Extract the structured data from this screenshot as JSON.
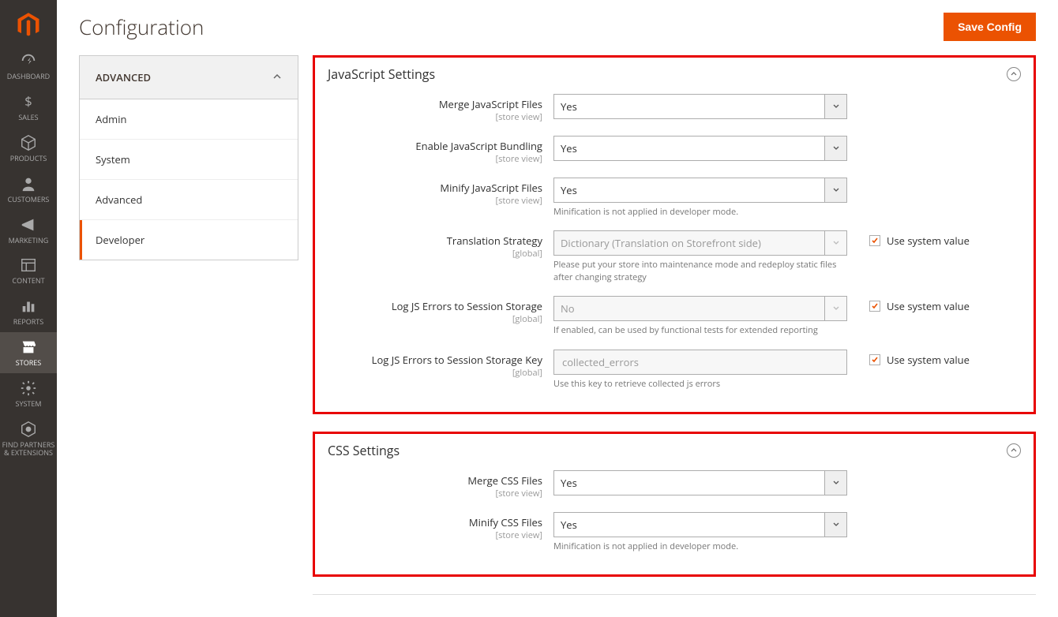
{
  "page": {
    "title": "Configuration",
    "save_button": "Save Config"
  },
  "nav": {
    "items": [
      {
        "label": "DASHBOARD"
      },
      {
        "label": "SALES"
      },
      {
        "label": "PRODUCTS"
      },
      {
        "label": "CUSTOMERS"
      },
      {
        "label": "MARKETING"
      },
      {
        "label": "CONTENT"
      },
      {
        "label": "REPORTS"
      },
      {
        "label": "STORES"
      },
      {
        "label": "SYSTEM"
      },
      {
        "label": "FIND PARTNERS & EXTENSIONS"
      }
    ]
  },
  "sidebar": {
    "heading": "ADVANCED",
    "items": [
      {
        "label": "Admin"
      },
      {
        "label": "System"
      },
      {
        "label": "Advanced"
      },
      {
        "label": "Developer"
      }
    ]
  },
  "js": {
    "title": "JavaScript Settings",
    "merge_label": "Merge JavaScript Files",
    "merge_scope": "[store view]",
    "merge_value": "Yes",
    "bundle_label": "Enable JavaScript Bundling",
    "bundle_scope": "[store view]",
    "bundle_value": "Yes",
    "minify_label": "Minify JavaScript Files",
    "minify_scope": "[store view]",
    "minify_value": "Yes",
    "minify_note": "Minification is not applied in developer mode.",
    "trans_label": "Translation Strategy",
    "trans_scope": "[global]",
    "trans_value": "Dictionary (Translation on Storefront side)",
    "trans_note": "Please put your store into maintenance mode and redeploy static files after changing strategy",
    "log_label": "Log JS Errors to Session Storage",
    "log_scope": "[global]",
    "log_value": "No",
    "log_note": "If enabled, can be used by functional tests for extended reporting",
    "logkey_label": "Log JS Errors to Session Storage Key",
    "logkey_scope": "[global]",
    "logkey_value": "collected_errors",
    "logkey_note": "Use this key to retrieve collected js errors"
  },
  "css": {
    "title": "CSS Settings",
    "merge_label": "Merge CSS Files",
    "merge_scope": "[store view]",
    "merge_value": "Yes",
    "minify_label": "Minify CSS Files",
    "minify_scope": "[store view]",
    "minify_value": "Yes",
    "minify_note": "Minification is not applied in developer mode."
  },
  "use_system_label": "Use system value"
}
